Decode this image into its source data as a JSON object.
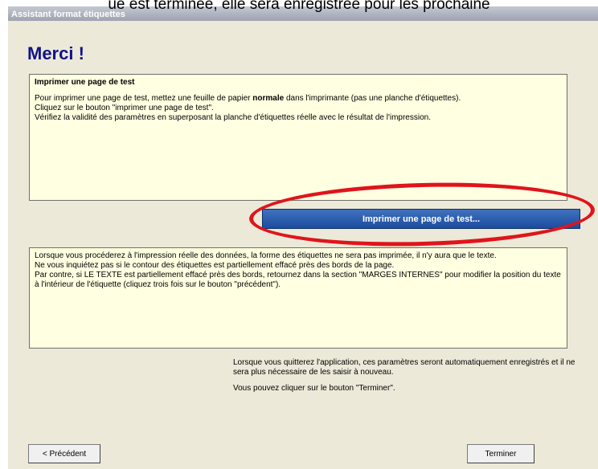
{
  "overlay_caption": "ue est terminée, elle sera enregistrée pour les prochaine",
  "window": {
    "title": "Assistant format étiquettes"
  },
  "heading": "Merci !",
  "test_panel": {
    "title": "Imprimer une page de test",
    "line1_before_bold": "Pour imprimer une page de test, mettez une feuille de papier ",
    "line1_bold": "normale",
    "line1_after_bold": " dans l'imprimante (pas une planche d'étiquettes).",
    "line2": "Cliquez sur le bouton \"imprimer une page de test\".",
    "line3": "Vérifiez la validité des paramètres en superposant la planche d'étiquettes réelle avec le résultat de l'impression."
  },
  "test_button_label": "Imprimer une page de test...",
  "notes_panel": {
    "line1": "Lorsque vous procéderez à l'impression réelle des données, la forme des étiquettes ne sera pas imprimée, il n'y aura que le texte.",
    "line2": "Ne vous inquiétez pas si le contour des étiquettes est partiellement effacé près des bords de la page.",
    "line3": "Par contre, si LE TEXTE est partiellement effacé près des bords, retournez dans la section \"MARGES INTERNES\" pour modifier la position du texte à l'intérieur de l'étiquette (cliquez trois fois sur le bouton \"précédent\")."
  },
  "info": {
    "line1": "Lorsque vous quitterez l'application, ces paramètres seront automatiquement enregistrés et il ne sera plus nécessaire de les saisir à nouveau.",
    "line2": "Vous pouvez cliquer sur le bouton \"Terminer\"."
  },
  "buttons": {
    "previous": "< Précédent",
    "finish": "Terminer"
  },
  "colors": {
    "heading": "#12128a",
    "panel_bg": "#ffffe1",
    "button_blue": "#2a5aaa",
    "highlight_ring": "#e0141b"
  }
}
